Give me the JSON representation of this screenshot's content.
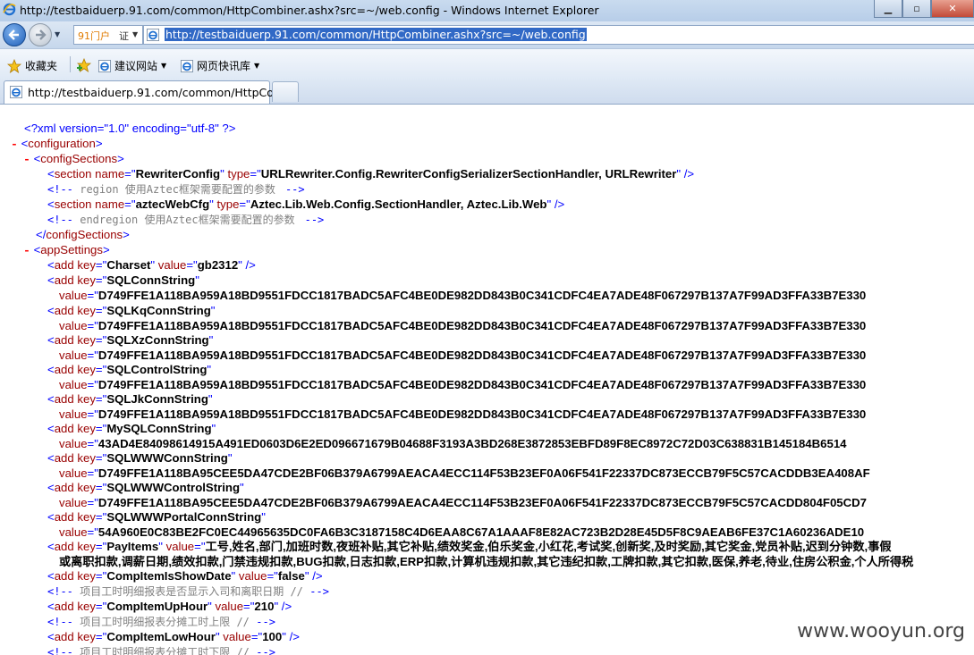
{
  "window": {
    "title": "http://testbaiduerp.91.com/common/HttpCombiner.ashx?src=~/web.config - Windows Internet Explorer"
  },
  "addressbar": {
    "site_name": "91门户",
    "site_badge": "证",
    "url": "http://testbaiduerp.91.com/common/HttpCombiner.ashx?src=~/web.config"
  },
  "favorites": {
    "favorites_label": "收藏夹",
    "suggested_sites": "建议网站",
    "web_slices": "网页快讯库"
  },
  "tab": {
    "title": "http://testbaiduerp.91.com/common/HttpCo..."
  },
  "xml": {
    "pi": "<?xml version=\"1.0\" encoding=\"utf-8\" ?>",
    "configuration": "configuration",
    "configSections": "configSections",
    "section1_name": "RewriterConfig",
    "section1_type": "URLRewriter.Config.RewriterConfigSerializerSectionHandler, URLRewriter",
    "comment1": "region 使用Aztec框架需要配置的参数",
    "section2_name": "aztecWebCfg",
    "section2_type": "Aztec.Lib.Web.Config.SectionHandler, Aztec.Lib.Web",
    "comment2": "endregion 使用Aztec框架需要配置的参数",
    "appSettings": "appSettings",
    "charset_key": "Charset",
    "charset_value": "gb2312",
    "sqlconn_key": "SQLConnString",
    "sqlkq_key": "SQLKqConnString",
    "sqlxz_key": "SQLXzConnString",
    "sqlcontrol_key": "SQLControlString",
    "sqljk_key": "SQLJkConnString",
    "common_conn_value": "D749FFE1A118BA959A18BD9551FDCC1817BADC5AFC4BE0DE982DD843B0C341CDFC4EA7ADE48F067297B137A7F99AD3FFA33B7E330",
    "mysql_key": "MySQLConnString",
    "mysql_value": "43AD4E84098614915A491ED0603D6E2ED096671679B04688F3193A3BD268E3872853EBFD89F8EC8972C72D03C638831B145184B6514",
    "sqlwww_key": "SQLWWWConnString",
    "sqlwww_value": "D749FFE1A118BA95CEE5DA47CDE2BF06B379A6799AEACA4ECC114F53B23EF0A06F541F22337DC873ECCB79F5C57CACDDB3EA408AF",
    "sqlwwwcontrol_key": "SQLWWWControlString",
    "sqlwwwcontrol_value": "D749FFE1A118BA95CEE5DA47CDE2BF06B379A6799AEACA4ECC114F53B23EF0A06F541F22337DC873ECCB79F5C57CACDD804F05CD7",
    "sqlwwwportal_key": "SQLWWWPortalConnString",
    "sqlwwwportal_value": "54A960E0C83BE2FC0EC44965635DC0FA6B3C3187158C4D6EAA8C67A1AAAF8E82AC723B2D28E45D5F8C9AEAB6FE37C1A60236ADE10",
    "payitems_key": "PayItems",
    "payitems_value1": "工号,姓名,部门,加班时数,夜班补贴,其它补贴,绩效奖金,伯乐奖金,小红花,考试奖,创新奖,及时奖励,其它奖金,党员补贴,迟到分钟数,事假",
    "payitems_value2": "或离职扣款,调薪日期,绩效扣款,门禁违规扣款,BUG扣款,日志扣款,ERP扣款,计算机违规扣款,其它违纪扣款,工牌扣款,其它扣款,医保,养老,待业,住房公积金,个人所得税",
    "showdate_key": "CompItemIsShowDate",
    "showdate_value": "false",
    "comment3": "项目工时明细报表是否显示入司和离职日期 //",
    "uphour_key": "CompItemUpHour",
    "uphour_value": "210",
    "comment4": "项目工时明细报表分摊工时上限 //",
    "lowhour_key": "CompItemLowHour",
    "lowhour_value": "100",
    "comment5": "项目工时明细报表分摊工时下限 //"
  },
  "watermark": "www.wooyun.org"
}
